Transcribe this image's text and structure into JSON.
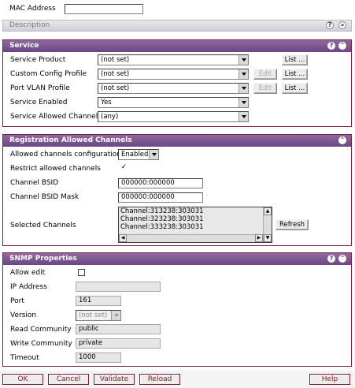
{
  "top": {
    "mac_label": "MAC Address",
    "mac_value": "",
    "description_label": "Description"
  },
  "service": {
    "title": "Service",
    "rows": [
      {
        "label": "Service Product",
        "value": "(not set)",
        "edit": "",
        "list": "List ..."
      },
      {
        "label": "Custom Config Profile",
        "value": "(not set)",
        "edit": "Edit",
        "list": "List ..."
      },
      {
        "label": "Port VLAN Profile",
        "value": "(not set)",
        "edit": "Edit",
        "list": "List ..."
      },
      {
        "label": "Service Enabled",
        "value": "Yes"
      },
      {
        "label": "Service Allowed Channel",
        "value": "(any)"
      }
    ]
  },
  "registration": {
    "title": "Registration Allowed Channels",
    "allowed_config_label": "Allowed channels configuration",
    "allowed_config_value": "Enabled",
    "restrict_label": "Restrict allowed channels",
    "restrict_checked": "✓",
    "bsid_label": "Channel BSID",
    "bsid_value": "000000:000000",
    "bsid_mask_label": "Channel BSID Mask",
    "bsid_mask_value": "000000:000000",
    "selected_label": "Selected Channels",
    "channels": [
      "Channel:313238:303031",
      "Channel:323238:303031",
      "Channel:333238:303031"
    ],
    "refresh_label": "Refresh"
  },
  "snmp": {
    "title": "SNMP Properties",
    "allow_edit_label": "Allow edit",
    "ip_label": "IP Address",
    "ip_value": "",
    "port_label": "Port",
    "port_value": "161",
    "version_label": "Version",
    "version_value": "(not set)",
    "read_label": "Read Community",
    "read_value": "public",
    "write_label": "Write Community",
    "write_value": "private",
    "timeout_label": "Timeout",
    "timeout_value": "1000"
  },
  "footer": {
    "ok": "OK",
    "cancel": "Cancel",
    "validate": "Validate",
    "reload": "Reload",
    "help": "Help"
  },
  "colors": {
    "panel_border": "#7a1f3a",
    "panel_header": "#6b4683"
  }
}
